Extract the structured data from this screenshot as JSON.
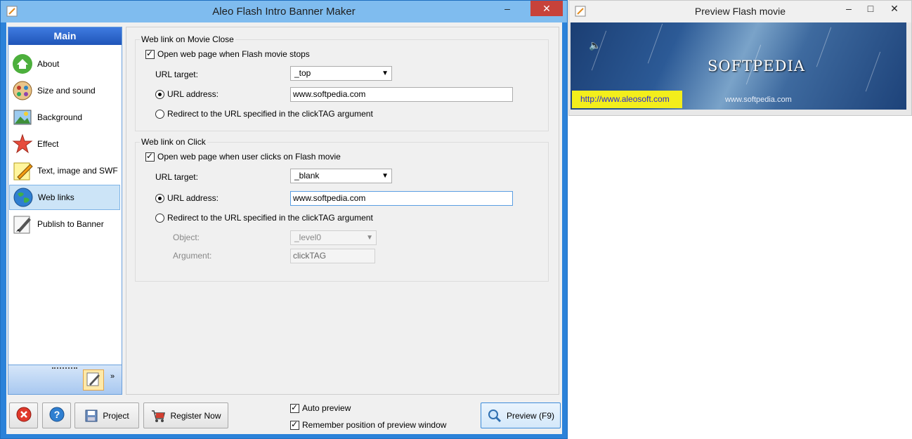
{
  "main_window": {
    "title": "Aleo Flash Intro Banner Maker",
    "minimize": "‒",
    "close": "✕"
  },
  "sidebar": {
    "header": "Main",
    "items": [
      {
        "label": "About",
        "icon": "home-icon"
      },
      {
        "label": "Size and sound",
        "icon": "film-reel-icon"
      },
      {
        "label": "Background",
        "icon": "picture-icon"
      },
      {
        "label": "Effect",
        "icon": "star-burst-icon"
      },
      {
        "label": "Text, image and SWF",
        "icon": "pencil-note-icon"
      },
      {
        "label": "Web links",
        "icon": "globe-icon",
        "selected": true
      },
      {
        "label": "Publish to Banner",
        "icon": "brush-pen-icon"
      }
    ],
    "more": "»"
  },
  "movie_close": {
    "title": "Web link on Movie Close",
    "open_checkbox": "Open web page when Flash movie stops",
    "url_target_label": "URL target:",
    "url_target_value": "_top",
    "url_address_label": "URL address:",
    "url_address_value": "www.softpedia.com",
    "redirect_label": "Redirect to the URL specified in the clickTAG argument"
  },
  "on_click": {
    "title": "Web link on Click",
    "open_checkbox": "Open web page when user clicks on Flash movie",
    "url_target_label": "URL target:",
    "url_target_value": "_blank",
    "url_address_label": "URL address:",
    "url_address_value": "www.softpedia.com",
    "redirect_label": "Redirect to the URL specified in the clickTAG argument",
    "object_label": "Object:",
    "object_value": "_level0",
    "argument_label": "Argument:",
    "argument_value": "clickTAG"
  },
  "bottom_bar": {
    "project": "Project",
    "register": "Register Now",
    "auto_preview": "Auto preview",
    "remember_position": "Remember position of preview window",
    "preview": "Preview (F9)"
  },
  "preview_window": {
    "title": "Preview Flash movie",
    "minimize": "‒",
    "maximize": "□",
    "close": "✕",
    "banner_logo": "SOFTPEDIA",
    "banner_link": "http://www.aleosoft.com",
    "banner_small": "www.softpedia.com"
  },
  "colors": {
    "accent": "#2b82d9",
    "sidebar_header": "#2c66c8",
    "selected_item": "#cce4f7",
    "close_red": "#c7423a"
  }
}
